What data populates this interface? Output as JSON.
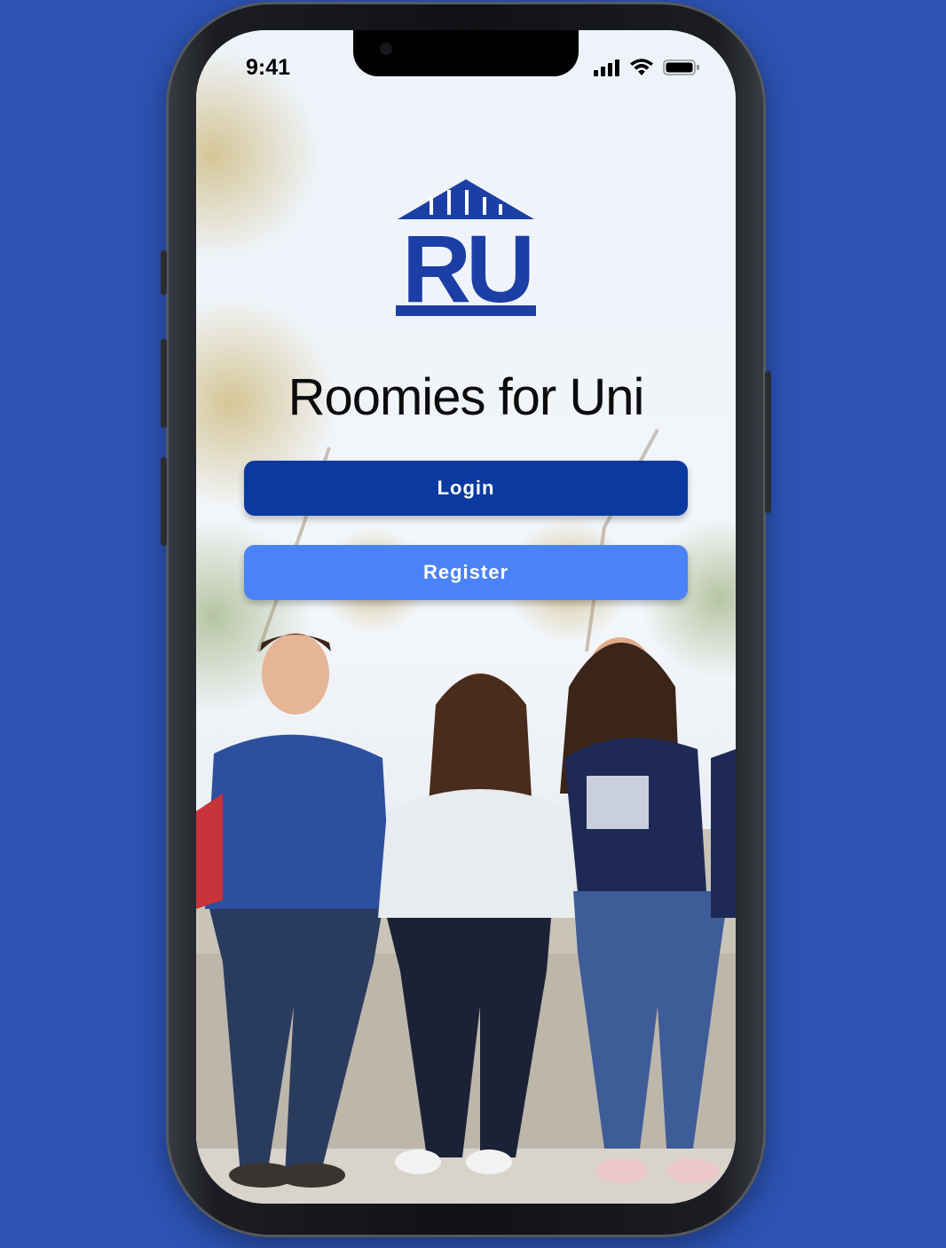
{
  "status_bar": {
    "time": "9:41",
    "signal_icon": "cellular-signal-icon",
    "wifi_icon": "wifi-icon",
    "battery_icon": "battery-icon"
  },
  "logo": {
    "text": "RU",
    "icon": "university-building-logo",
    "color": "#1c3fa5"
  },
  "app": {
    "title": "Roomies for Uni"
  },
  "buttons": {
    "login_label": "Login",
    "register_label": "Register"
  },
  "colors": {
    "background": "#2c52b2",
    "login_button": "#0a3aa0",
    "register_button": "#4a82f7"
  },
  "background_image": {
    "icon": "students-photo"
  }
}
